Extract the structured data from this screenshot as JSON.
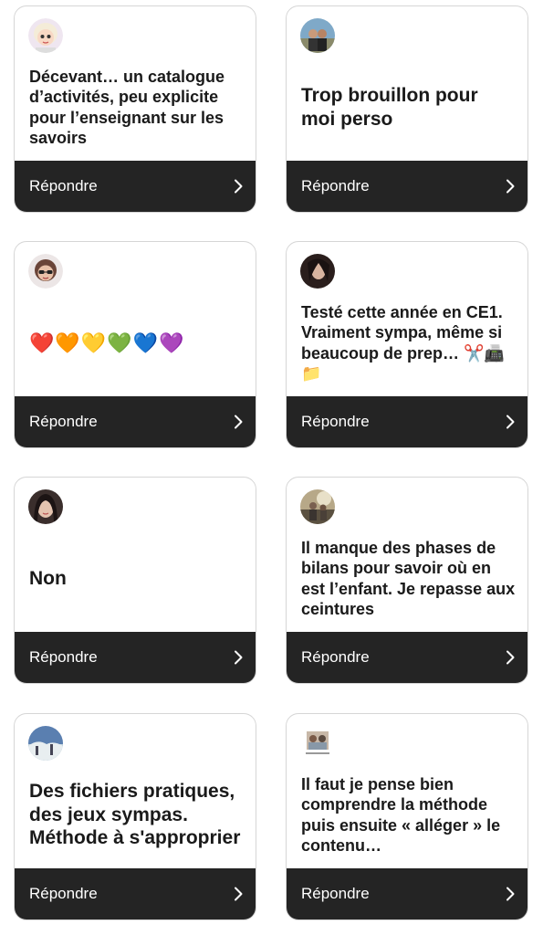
{
  "reply_label": "Répondre",
  "cards": [
    {
      "avatar": "cartoon-girl-avatar",
      "text": "Décevant… un catalogue d’activités, peu explicite pour l’enseignant sur les savoirs",
      "size": "m"
    },
    {
      "avatar": "couple-photo-avatar",
      "text": "Trop brouillon pour moi perso",
      "size": "l"
    },
    {
      "avatar": "cartoon-girl-glasses-avatar",
      "text": "❤️🧡💛💚💙💜",
      "size": "emoji"
    },
    {
      "avatar": "dark-hair-woman-avatar",
      "text": "Testé cette année en CE1. Vraiment sympa, même si beaucoup de prep… ✂️📠📁",
      "size": "m"
    },
    {
      "avatar": "woman-portrait-avatar",
      "text": "Non",
      "size": "l"
    },
    {
      "avatar": "outdoor-photo-avatar",
      "text": "Il manque des phases de bilans pour savoir où en est l’enfant. Je repasse aux ceintures",
      "size": "m"
    },
    {
      "avatar": "landscape-photo-avatar",
      "text": "Des fichiers pratiques, des jeux sympas. Méthode à s'approprier",
      "size": "l"
    },
    {
      "avatar": "small-photo-avatar",
      "text": "Il faut je pense bien comprendre la méthode puis ensuite « alléger » le contenu…",
      "size": "m"
    }
  ]
}
